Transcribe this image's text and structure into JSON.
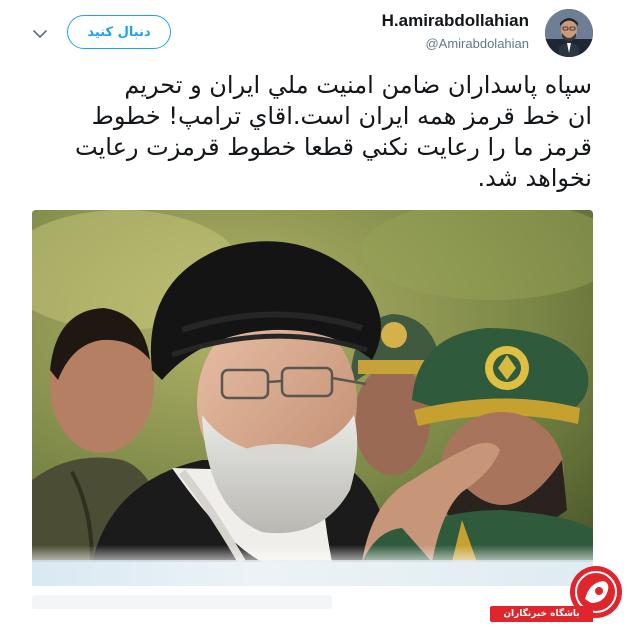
{
  "tweet": {
    "display_name": "H.amirabdollahian",
    "handle": "@Amirabdolahian",
    "follow_label": "دنبال کنید",
    "text": "سپاه پاسداران ضامن امنيت ملي ايران و تحريم\nان خط قرمز همه ايران است.اقاي ترامپ! خطوط\nقرمز ما را رعايت نكني قطعا خطوط قرمزت رعايت\nنخواهد شد.",
    "icons": {
      "menu": "chevron-down-icon",
      "avatar": "profile-avatar"
    }
  },
  "watermark": {
    "label": "باشگاه خبرنگاران",
    "colors": {
      "red": "#e0262d",
      "white": "#ffffff"
    }
  },
  "colors": {
    "accent": "#1da1f2",
    "text": "#14171a",
    "muted": "#657786"
  }
}
